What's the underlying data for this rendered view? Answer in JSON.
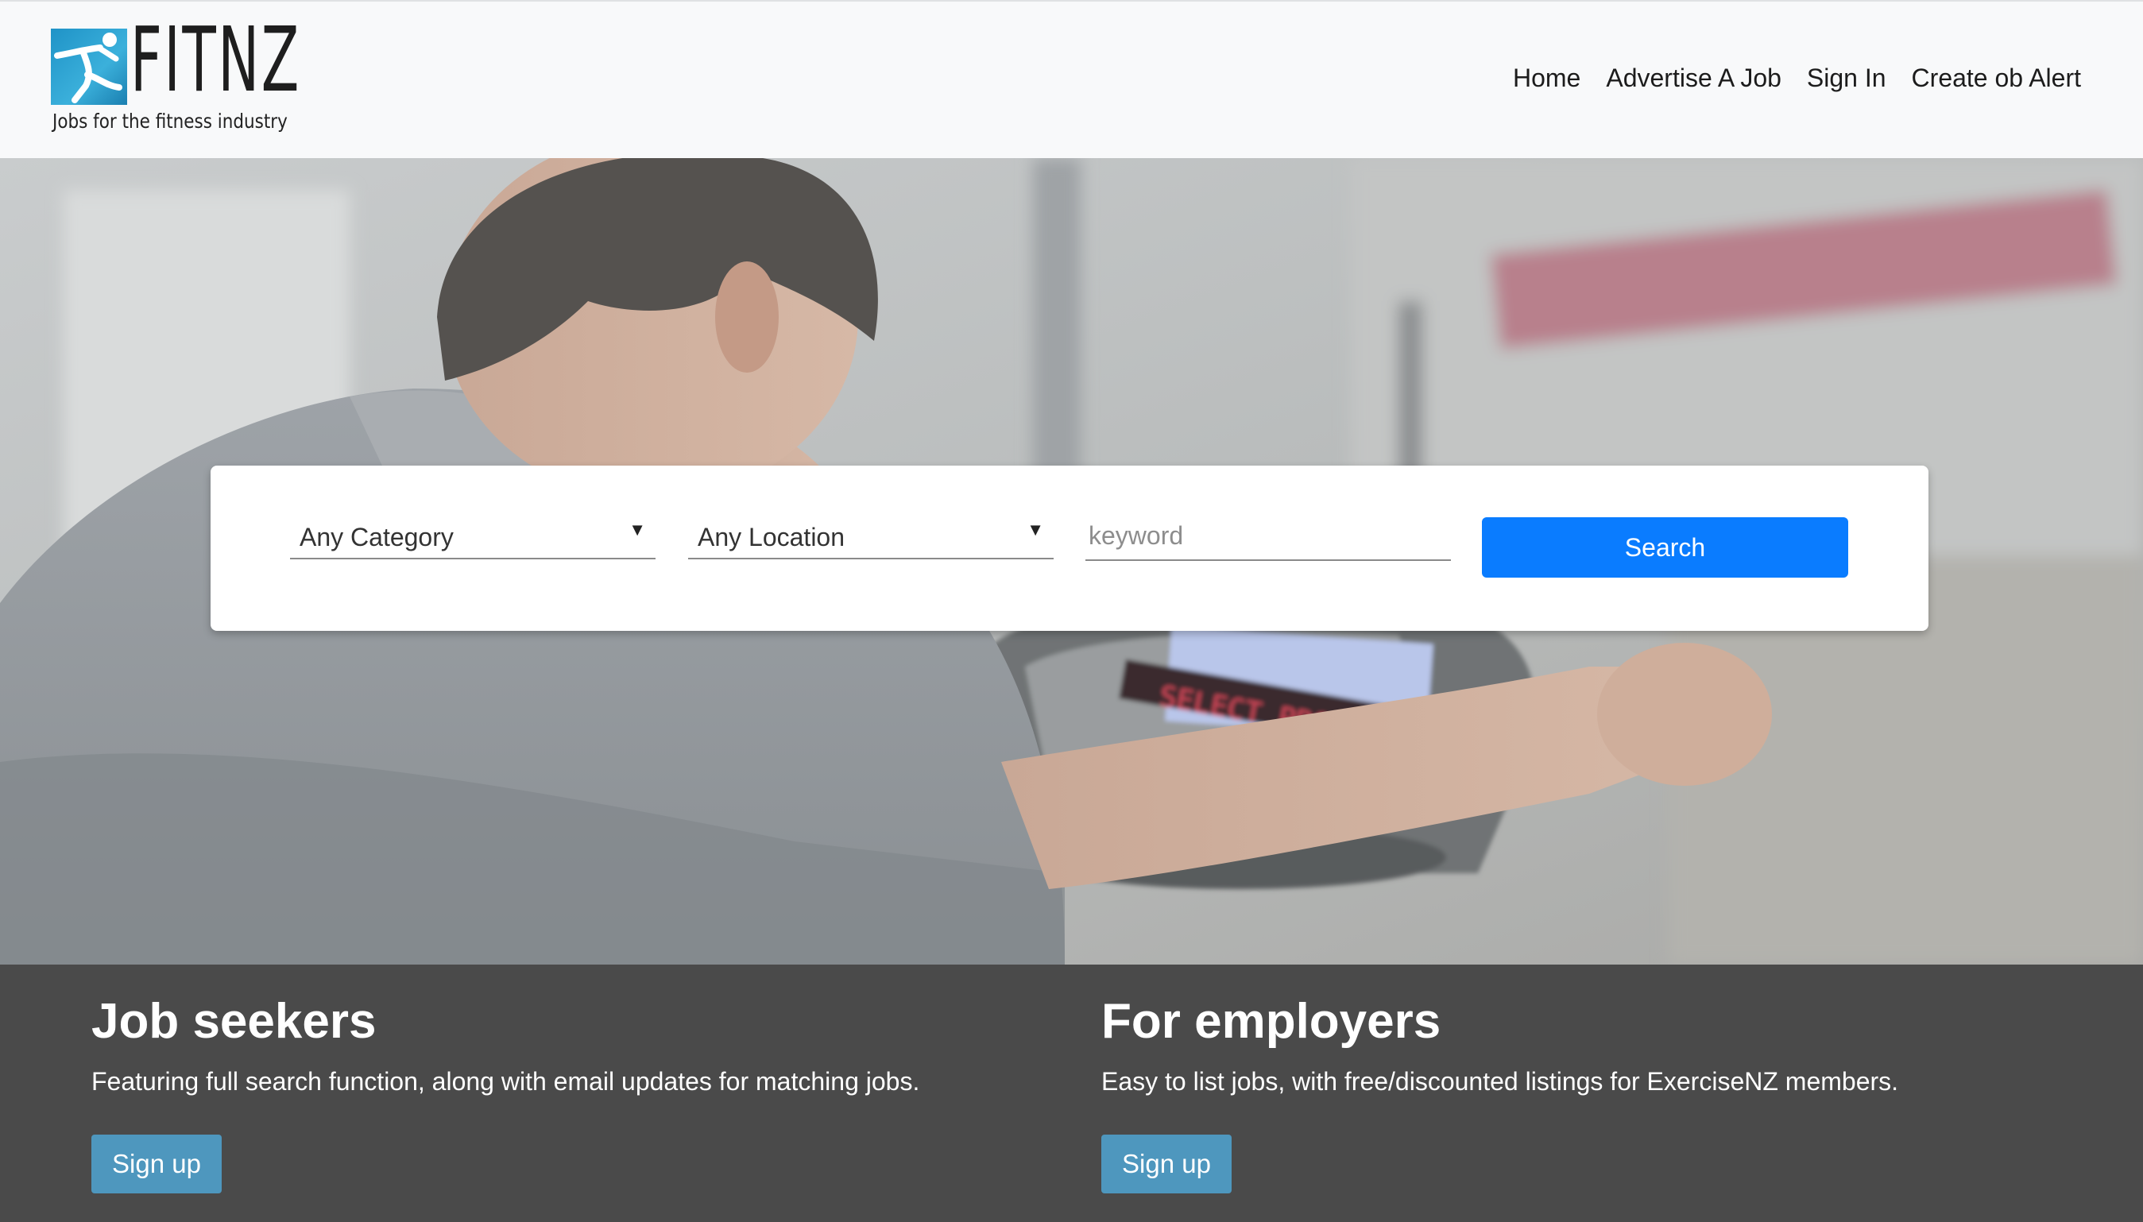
{
  "brand": {
    "name": "FITNZ",
    "tagline": "Jobs for the fitness industry",
    "logo_color": "#2aa3d4"
  },
  "nav": {
    "items": [
      {
        "label": "Home"
      },
      {
        "label": "Advertise A Job"
      },
      {
        "label": "Sign In"
      },
      {
        "label": "Create ob Alert"
      }
    ]
  },
  "search": {
    "category_selected": "Any Category",
    "location_selected": "Any Location",
    "keyword_placeholder": "keyword",
    "keyword_value": "",
    "button_label": "Search",
    "button_color": "#0a7cff"
  },
  "hero": {
    "image_icon": "man-on-exercise-bike-photo",
    "console_text": "SELECT PROG"
  },
  "panels": {
    "job_seekers": {
      "title": "Job seekers",
      "description": "Featuring full search function, along with email updates for matching jobs.",
      "button_label": "Sign up"
    },
    "employers": {
      "title": "For employers",
      "description": "Easy to list jobs, with free/discounted listings for ExerciseNZ members.",
      "button_label": "Sign up"
    },
    "background_color": "#4a4a4a",
    "button_color": "#4e97be"
  }
}
